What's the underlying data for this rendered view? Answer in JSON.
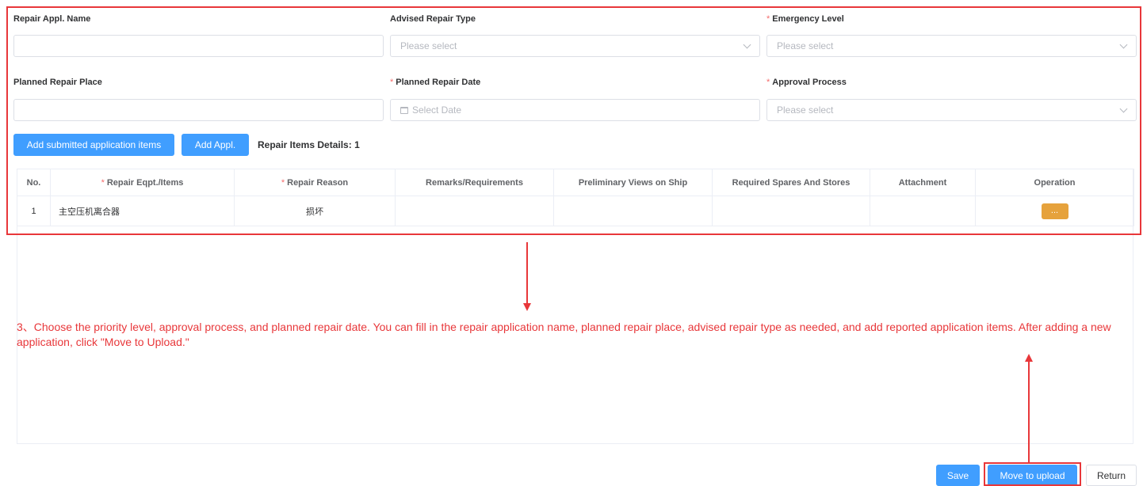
{
  "form": {
    "repair_appl_name_label": "Repair Appl. Name",
    "repair_appl_name_value": "",
    "advised_repair_type_label": "Advised Repair Type",
    "advised_repair_type_placeholder": "Please select",
    "emergency_level_label": "Emergency Level",
    "emergency_level_placeholder": "Please select",
    "planned_repair_place_label": "Planned Repair Place",
    "planned_repair_place_value": "",
    "planned_repair_date_label": "Planned Repair Date",
    "planned_repair_date_placeholder": "Select Date",
    "approval_process_label": "Approval Process",
    "approval_process_placeholder": "Please select",
    "required_mark": "*"
  },
  "actions": {
    "add_submitted_label": "Add submitted application items",
    "add_appl_label": "Add Appl.",
    "details_label": "Repair Items Details",
    "details_count": "1"
  },
  "table": {
    "columns": [
      "No.",
      "Repair Eqpt./Items",
      "Repair Reason",
      "Remarks/Requirements",
      "Preliminary Views on Ship",
      "Required Spares And Stores",
      "Attachment",
      "Operation"
    ],
    "rows": [
      {
        "no": "1",
        "item": "主空压机离合器",
        "reason": "损坏",
        "remarks": "",
        "views": "",
        "spares": "",
        "attachment": "",
        "operation": "..."
      }
    ]
  },
  "annotation": {
    "instruction": "3、Choose the priority level, approval process, and planned repair date. You can fill in the repair application name, planned repair place, advised repair type as needed, and add reported application items. After adding a new application, click \"Move to Upload.\"",
    "color": "#e8373a"
  },
  "footer": {
    "save_label": "Save",
    "move_to_upload_label": "Move to upload",
    "return_label": "Return"
  },
  "colors": {
    "primary": "#409eff",
    "warning": "#e6a23c",
    "required": "#f56c6c"
  }
}
